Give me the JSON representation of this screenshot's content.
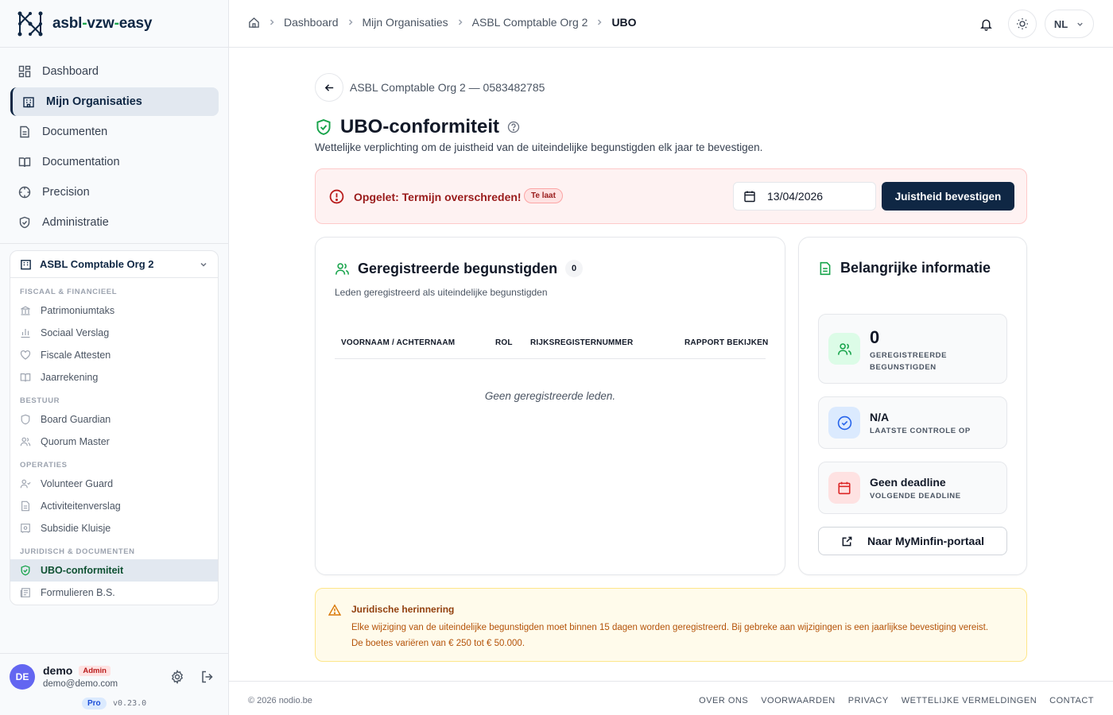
{
  "brand": {
    "name_part1": "asbl",
    "name_dash1": "-",
    "name_part2": "vzw",
    "name_dash2": "-",
    "name_part3": "easy"
  },
  "nav": {
    "items": [
      {
        "label": "Dashboard",
        "icon": "grid-icon"
      },
      {
        "label": "Mijn Organisaties",
        "icon": "building-icon",
        "active": true
      },
      {
        "label": "Documenten",
        "icon": "file-icon"
      },
      {
        "label": "Documentation",
        "icon": "book-icon"
      },
      {
        "label": "Precision",
        "icon": "crosshair-icon"
      },
      {
        "label": "Administratie",
        "icon": "shield-icon"
      }
    ]
  },
  "org": {
    "name": "ASBL Comptable Org 2",
    "sections": [
      {
        "label": "FISCAAL & FINANCIEEL",
        "items": [
          "Patrimoniumtaks",
          "Sociaal Verslag",
          "Fiscale Attesten",
          "Jaarrekening"
        ]
      },
      {
        "label": "BESTUUR",
        "items": [
          "Board Guardian",
          "Quorum Master"
        ]
      },
      {
        "label": "OPERATIES",
        "items": [
          "Volunteer Guard",
          "Activiteitenverslag",
          "Subsidie Kluisje"
        ]
      },
      {
        "label": "JURIDISCH & DOCUMENTEN",
        "items": [
          "UBO-conformiteit",
          "Formulieren B.S."
        ]
      }
    ]
  },
  "user": {
    "initials": "DE",
    "name": "demo",
    "role": "Admin",
    "email": "demo@demo.com",
    "plan": "Pro",
    "version": "v0.23.0"
  },
  "breadcrumb": {
    "items": [
      "Dashboard",
      "Mijn Organisaties",
      "ASBL Comptable Org 2"
    ],
    "current": "UBO"
  },
  "topbar": {
    "language": "NL"
  },
  "page": {
    "org_line": "ASBL Comptable Org 2 — 0583482785",
    "title": "UBO-conformiteit",
    "subtitle": "Wettelijke verplichting om de juistheid van de uiteindelijke begunstigden elk jaar te bevestigen."
  },
  "alert": {
    "text": "Opgelet: Termijn overschreden!",
    "badge": "Te laat",
    "date_value": "13/04/2026",
    "confirm_label": "Juistheid bevestigen"
  },
  "beneficiaries": {
    "title": "Geregistreerde begunstigden",
    "count": "0",
    "subtitle": "Leden geregistreerd als uiteindelijke begunstigden",
    "columns": [
      "VOORNAAM / ACHTERNAAM",
      "ROL",
      "RIJKSREGISTERNUMMER",
      "RAPPORT BEKIJKEN"
    ],
    "empty": "Geen geregistreerde leden."
  },
  "info": {
    "title": "Belangrijke informatie",
    "stats": [
      {
        "value": "0",
        "label_line1": "GEREGISTREERDE",
        "label_line2": "BEGUNSTIGDEN"
      },
      {
        "value": "N/A",
        "label_line1": "LAATSTE CONTROLE OP"
      },
      {
        "value": "Geen deadline",
        "label_line1": "VOLGENDE DEADLINE"
      }
    ],
    "portal_label": "Naar MyMinfin-portaal"
  },
  "legal": {
    "title": "Juridische herinnering",
    "line1": "Elke wijziging van de uiteindelijke begunstigden moet binnen 15 dagen worden geregistreerd. Bij gebreke aan wijzigingen is een jaarlijkse bevestiging vereist.",
    "line2": "De boetes variëren van € 250 tot € 50.000."
  },
  "footer": {
    "copyright": "© 2026 nodio.be",
    "links": [
      "OVER ONS",
      "VOORWAARDEN",
      "PRIVACY",
      "WETTELIJKE VERMELDINGEN",
      "CONTACT"
    ]
  },
  "colors": {
    "primary": "#0f2744",
    "success": "#16a34a",
    "danger": "#b91c1c",
    "warning": "#92400e"
  }
}
